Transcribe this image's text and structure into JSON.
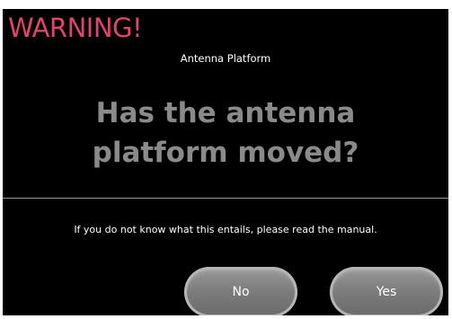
{
  "dialog": {
    "warning_title": "WARNING!",
    "subtitle": "Antenna Platform",
    "question": "Has the antenna platform moved?",
    "info": "If you do not know what this entails, please read the manual.",
    "buttons": {
      "no_label": "No",
      "yes_label": "Yes"
    }
  },
  "colors": {
    "background": "#000000",
    "warning": "#e0446a",
    "question_text": "#8a8a8a",
    "button": "#808080"
  }
}
